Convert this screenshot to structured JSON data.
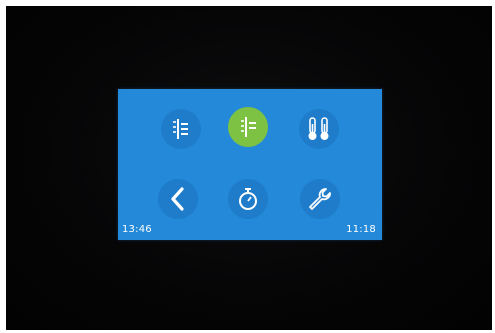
{
  "screen": {
    "background_color": "#2389d8",
    "active_color": "#7dc242",
    "buttons": [
      {
        "icon": "heating-zones-icon",
        "active": false
      },
      {
        "icon": "heating-zones-active-icon",
        "active": true
      },
      {
        "icon": "thermometers-icon",
        "active": false
      },
      {
        "icon": "back-icon",
        "active": false
      },
      {
        "icon": "timer-icon",
        "active": false
      },
      {
        "icon": "wrench-icon",
        "active": false
      }
    ],
    "status": {
      "left_time": "13:46",
      "right_time": "11:18"
    }
  }
}
